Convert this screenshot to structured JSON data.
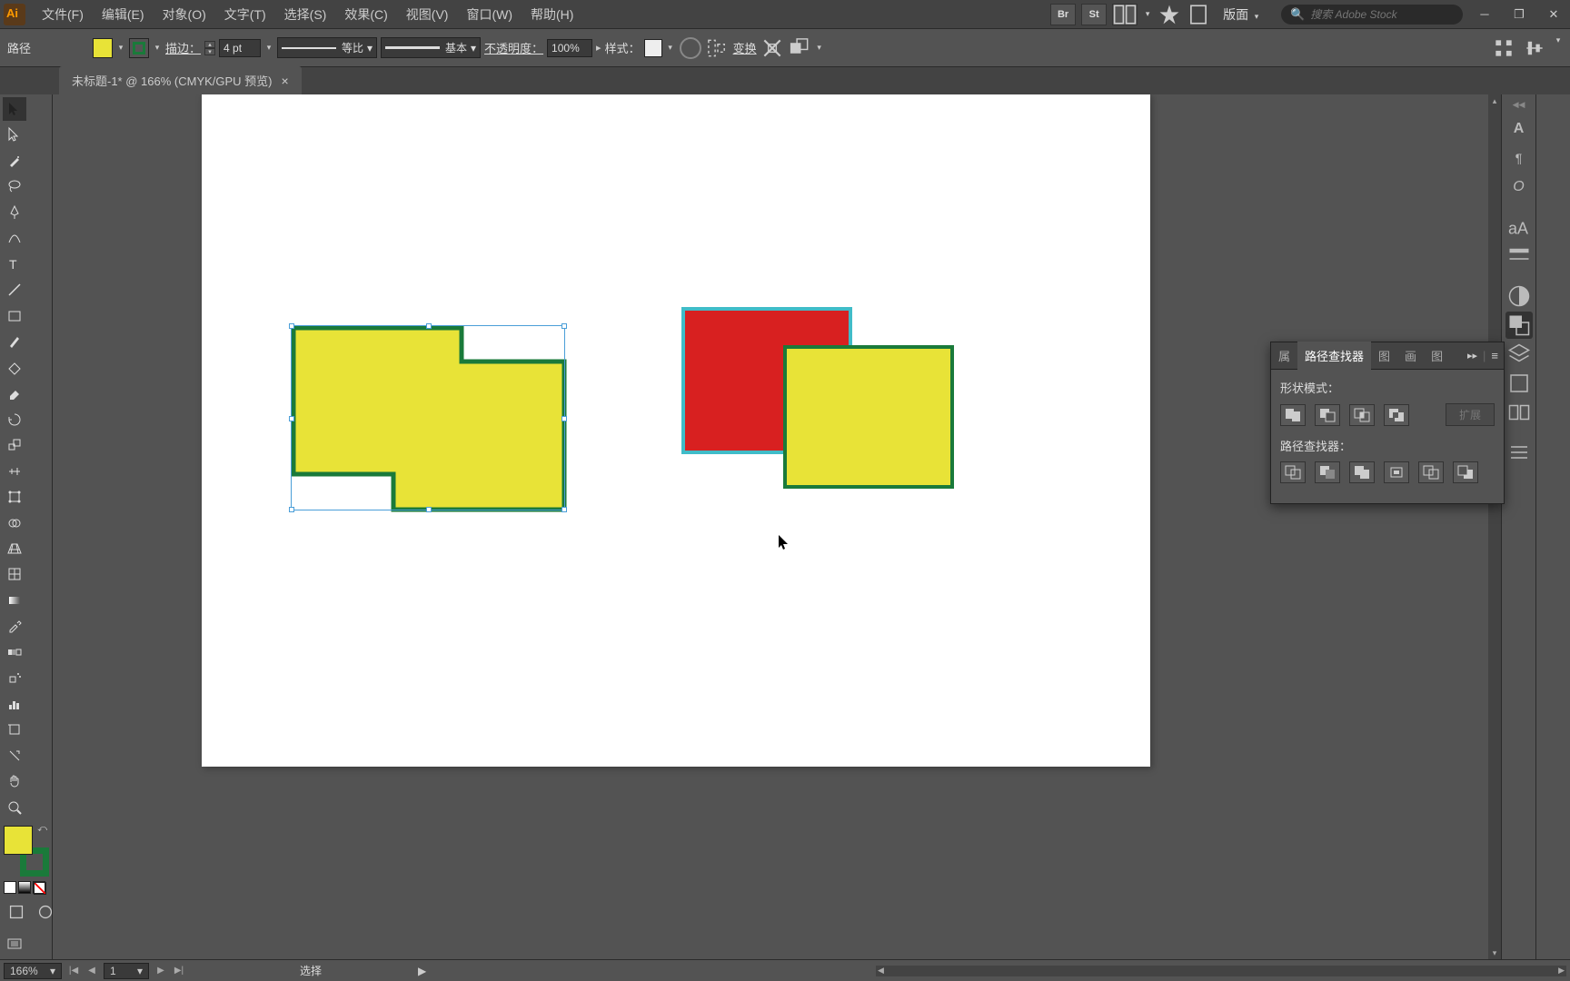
{
  "menu": {
    "items": [
      "文件(F)",
      "编辑(E)",
      "对象(O)",
      "文字(T)",
      "选择(S)",
      "效果(C)",
      "视图(V)",
      "窗口(W)",
      "帮助(H)"
    ],
    "apps": [
      "Br",
      "St"
    ],
    "workspace": "版面",
    "search_placeholder": "搜索 Adobe Stock"
  },
  "control": {
    "path_label": "路径",
    "stroke_label": "描边：",
    "stroke_weight": "4 pt",
    "profile_label": "等比",
    "brush_label": "基本",
    "opacity_label": "不透明度：",
    "opacity_value": "100%",
    "style_label": "样式：",
    "transform_label": "变换"
  },
  "document": {
    "tab_title": "未标题-1* @ 166% (CMYK/GPU 预览)"
  },
  "pathfinder": {
    "tabs": [
      "属",
      "路径查找器",
      "图",
      "画",
      "图"
    ],
    "shape_modes_label": "形状模式：",
    "pathfinders_label": "路径查找器：",
    "expand_label": "扩展"
  },
  "status": {
    "zoom": "166%",
    "artboard": "1",
    "tool": "选择"
  },
  "colors": {
    "fill": "#e8e337",
    "stroke": "#1a7a3a",
    "red": "#d82020",
    "cyan_stroke": "#40bcc8"
  }
}
